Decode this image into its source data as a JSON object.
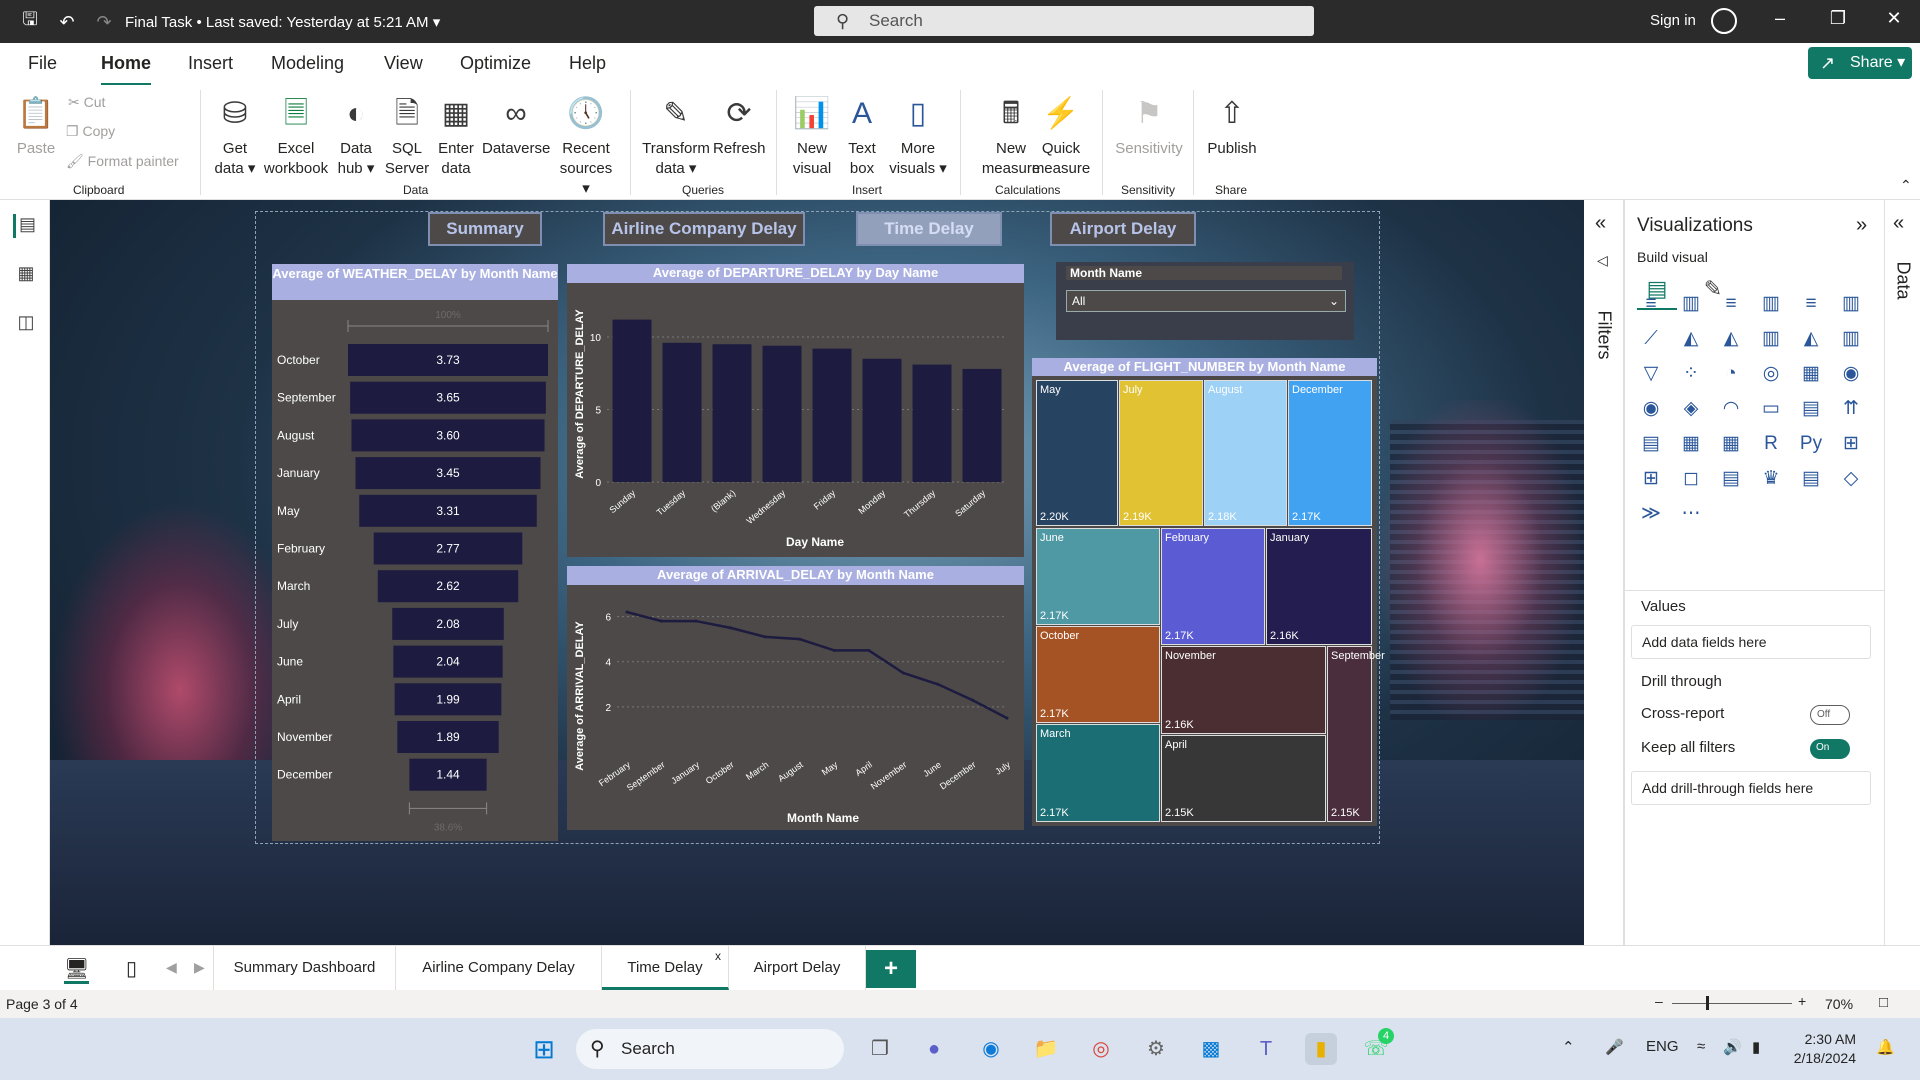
{
  "titlebar": {
    "doc_title": "Final Task",
    "saved_status": "Last saved: Yesterday at 5:21 AM",
    "search_placeholder": "Search",
    "signin": "Sign in"
  },
  "menu": {
    "items": [
      "File",
      "Home",
      "Insert",
      "Modeling",
      "View",
      "Optimize",
      "Help"
    ],
    "active": "Home",
    "share": "Share"
  },
  "ribbon": {
    "clipboard": {
      "paste": "Paste",
      "cut": "Cut",
      "copy": "Copy",
      "format_painter": "Format painter",
      "group": "Clipboard"
    },
    "data": {
      "get_data": "Get data",
      "excel": "Excel workbook",
      "data_hub": "Data hub",
      "sql": "SQL Server",
      "enter": "Enter data",
      "dataverse": "Dataverse",
      "recent": "Recent sources",
      "group": "Data"
    },
    "queries": {
      "transform": "Transform data",
      "refresh": "Refresh",
      "group": "Queries"
    },
    "insert": {
      "new_visual": "New visual",
      "text_box": "Text box",
      "more_visuals": "More visuals",
      "group": "Insert"
    },
    "calculations": {
      "new_measure": "New measure",
      "quick_measure": "Quick measure",
      "group": "Calculations"
    },
    "sensitivity": {
      "label": "Sensitivity",
      "group": "Sensitivity"
    },
    "share": {
      "publish": "Publish",
      "group": "Share"
    }
  },
  "report": {
    "nav_buttons": [
      "Summary",
      "Airline Company Delay",
      "Time Delay",
      "Airport Delay"
    ],
    "slicer": {
      "title": "Month Name",
      "value": "All"
    }
  },
  "weather_chart": {
    "title": "Average of WEATHER_DELAY by Month Name",
    "axis_top": "100%",
    "axis_bottom": "38.6%"
  },
  "departure_chart": {
    "title": "Average of DEPARTURE_DELAY by Day Name",
    "xlabel": "Day Name",
    "ylabel": "Average of DEPARTURE_DELAY"
  },
  "arrival_chart": {
    "title": "Average of ARRIVAL_DELAY by Month Name",
    "xlabel": "Month Name",
    "ylabel": "Average of ARRIVAL_DELAY"
  },
  "treemap_chart": {
    "title": "Average of FLIGHT_NUMBER by Month Name"
  },
  "chart_data": [
    {
      "type": "bar",
      "title": "Average of WEATHER_DELAY by Month Name",
      "categories": [
        "October",
        "September",
        "August",
        "January",
        "May",
        "February",
        "March",
        "July",
        "June",
        "April",
        "November",
        "December"
      ],
      "values": [
        3.73,
        3.65,
        3.6,
        3.45,
        3.31,
        2.77,
        2.62,
        2.08,
        2.04,
        1.99,
        1.89,
        1.44
      ],
      "labels": [
        "3.73",
        "3.65",
        "3.60",
        "3.45",
        "3.31",
        "2.77",
        "2.62",
        "2.08",
        "2.04",
        "1.99",
        "1.89",
        "1.44"
      ]
    },
    {
      "type": "bar",
      "title": "Average of DEPARTURE_DELAY by Day Name",
      "categories": [
        "Sunday",
        "Tuesday",
        "(Blank)",
        "Wednesday",
        "Friday",
        "Monday",
        "Thursday",
        "Saturday"
      ],
      "values": [
        11.2,
        9.6,
        9.5,
        9.4,
        9.2,
        8.5,
        8.1,
        7.8
      ],
      "xlabel": "Day Name",
      "ylabel": "Average of DEPARTURE_DELAY",
      "ylim": [
        0,
        12
      ],
      "yticks": [
        "0",
        "5",
        "10"
      ]
    },
    {
      "type": "line",
      "title": "Average of ARRIVAL_DELAY by Month Name",
      "categories": [
        "February",
        "September",
        "January",
        "October",
        "March",
        "August",
        "May",
        "April",
        "November",
        "June",
        "December",
        "July"
      ],
      "values": [
        6.2,
        5.8,
        5.8,
        5.5,
        5.1,
        5.0,
        4.5,
        4.5,
        3.5,
        3.0,
        2.3,
        1.5
      ],
      "xlabel": "Month Name",
      "ylabel": "Average of ARRIVAL_DELAY",
      "ylim": [
        0,
        7
      ],
      "yticks": [
        "2",
        "4",
        "6"
      ]
    },
    {
      "type": "heatmap",
      "title": "Average of FLIGHT_NUMBER by Month Name",
      "categories": [
        "May",
        "July",
        "August",
        "December",
        "June",
        "February",
        "January",
        "October",
        "November",
        "September",
        "March",
        "April"
      ],
      "labels": [
        "2.20K",
        "2.19K",
        "2.18K",
        "2.17K",
        "2.17K",
        "2.17K",
        "2.16K",
        "2.17K",
        "2.16K",
        "2.15K",
        "2.17K",
        "2.15K"
      ],
      "colors": [
        "#264361",
        "#e1c233",
        "#9dd1f6",
        "#42a2f2",
        "#4f99a5",
        "#5b5bd4",
        "#241d4f",
        "#a55324",
        "#4b2e32",
        "#4b2e3d",
        "#1b6e74",
        "#373737"
      ]
    }
  ],
  "visualizations": {
    "title": "Visualizations",
    "build_visual": "Build visual",
    "values_label": "Values",
    "values_placeholder": "Add data fields here",
    "drill_through": "Drill through",
    "cross_report": "Cross-report",
    "cross_report_state": "Off",
    "keep_filters": "Keep all filters",
    "keep_filters_state": "On",
    "drill_placeholder": "Add drill-through fields here"
  },
  "filters_label": "Filters",
  "data_label": "Data",
  "pages": {
    "tabs": [
      "Summary Dashboard",
      "Airline Company Delay",
      "Time Delay",
      "Airport Delay"
    ],
    "active": "Time Delay",
    "page_indicator": "Page 3 of 4",
    "zoom": "70%"
  },
  "taskbar": {
    "search": "Search",
    "lang": "ENG",
    "time": "2:30 AM",
    "date": "2/18/2024",
    "whatsapp_badge": "4"
  }
}
